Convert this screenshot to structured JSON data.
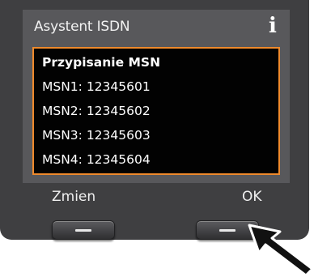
{
  "screen": {
    "title": "Asystent ISDN",
    "info_icon": "info-icon"
  },
  "content": {
    "heading": "Przypisanie MSN",
    "lines": [
      "MSN1: 12345601",
      "MSN2: 12345602",
      "MSN3: 12345603",
      "MSN4: 12345604"
    ]
  },
  "softkeys": {
    "left_label": "Zmien",
    "right_label": "OK"
  },
  "colors": {
    "accent": "#ef8a2c",
    "body": "#3f3f41",
    "screen": "#58585b",
    "content_bg": "#020202"
  }
}
